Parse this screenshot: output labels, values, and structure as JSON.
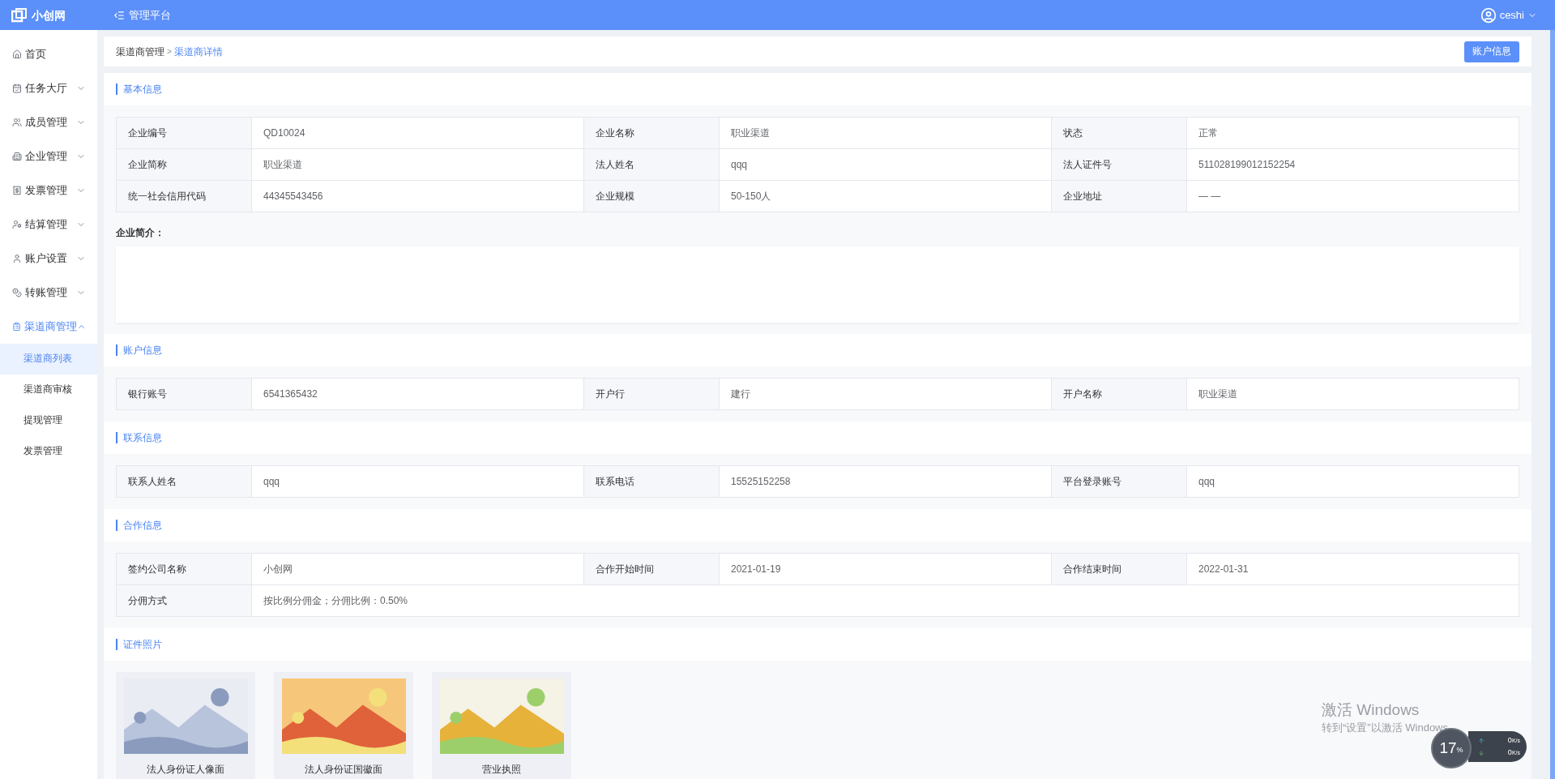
{
  "header": {
    "logo_text": "小创网",
    "platform": "管理平台",
    "user": "ceshi"
  },
  "sidebar": {
    "items": [
      {
        "label": "首页",
        "kind": "link",
        "selected": false
      },
      {
        "label": "任务大厅",
        "kind": "menu",
        "expanded": false,
        "selected": false
      },
      {
        "label": "成员管理",
        "kind": "menu",
        "expanded": false,
        "selected": false
      },
      {
        "label": "企业管理",
        "kind": "menu",
        "expanded": false,
        "selected": false
      },
      {
        "label": "发票管理",
        "kind": "menu",
        "expanded": false,
        "selected": false
      },
      {
        "label": "结算管理",
        "kind": "menu",
        "expanded": false,
        "selected": false
      },
      {
        "label": "账户设置",
        "kind": "menu",
        "expanded": false,
        "selected": false
      },
      {
        "label": "转账管理",
        "kind": "menu",
        "expanded": false,
        "selected": false
      },
      {
        "label": "渠道商管理",
        "kind": "menu",
        "expanded": true,
        "selected": true,
        "children": [
          {
            "label": "渠道商列表",
            "selected": true
          },
          {
            "label": "渠道商审核",
            "selected": false
          },
          {
            "label": "提现管理",
            "selected": false
          },
          {
            "label": "发票管理",
            "selected": false
          }
        ]
      }
    ]
  },
  "breadcrumb": [
    "渠道商管理",
    "渠道商详情"
  ],
  "breadcrumb_separator": ">",
  "account_button": "账户信息",
  "sections": [
    {
      "title": "基本信息",
      "kind": "table",
      "rows": [
        [
          {
            "label": "企业编号",
            "value": "QD10024"
          },
          {
            "label": "企业名称",
            "value": "职业渠道"
          },
          {
            "label": "状态",
            "value": "正常"
          }
        ],
        [
          {
            "label": "企业简称",
            "value": "职业渠道"
          },
          {
            "label": "法人姓名",
            "value": "qqq"
          },
          {
            "label": "法人证件号",
            "value": "511028199012152254"
          }
        ],
        [
          {
            "label": "统一社会信用代码",
            "value": "44345543456"
          },
          {
            "label": "企业规模",
            "value": "50-150人"
          },
          {
            "label": "企业地址",
            "value": "— —"
          }
        ]
      ],
      "intro": {
        "label": "企业简介："
      }
    },
    {
      "title": "账户信息",
      "kind": "table",
      "rows": [
        [
          {
            "label": "银行账号",
            "value": "6541365432"
          },
          {
            "label": "开户行",
            "value": "建行"
          },
          {
            "label": "开户名称",
            "value": "职业渠道"
          }
        ]
      ]
    },
    {
      "title": "联系信息",
      "kind": "table",
      "rows": [
        [
          {
            "label": "联系人姓名",
            "value": "qqq"
          },
          {
            "label": "联系电话",
            "value": "15525152258"
          },
          {
            "label": "平台登录账号",
            "value": "qqq"
          }
        ]
      ]
    },
    {
      "title": "合作信息",
      "kind": "table",
      "rows": [
        [
          {
            "label": "签约公司名称",
            "value": "小创网"
          },
          {
            "label": "合作开始时间",
            "value": "2021-01-19"
          },
          {
            "label": "合作结束时间",
            "value": "2022-01-31"
          }
        ],
        [
          {
            "label": "分佣方式",
            "value": "按比例分佣金；分佣比例：0.50%"
          }
        ]
      ]
    },
    {
      "title": "证件照片",
      "kind": "photos",
      "photos": [
        {
          "caption": "法人身份证人像面"
        },
        {
          "caption": "法人身份证国徽面"
        },
        {
          "caption": "营业执照"
        }
      ]
    }
  ],
  "os_notice": {
    "title": "激活 Windows",
    "text": "转到“设置”以激活 Windows"
  },
  "speed_widget": {
    "percent": "17",
    "unit": "%",
    "up": "0",
    "up_unit": "K/s",
    "down": "0",
    "down_unit": "K/s"
  }
}
